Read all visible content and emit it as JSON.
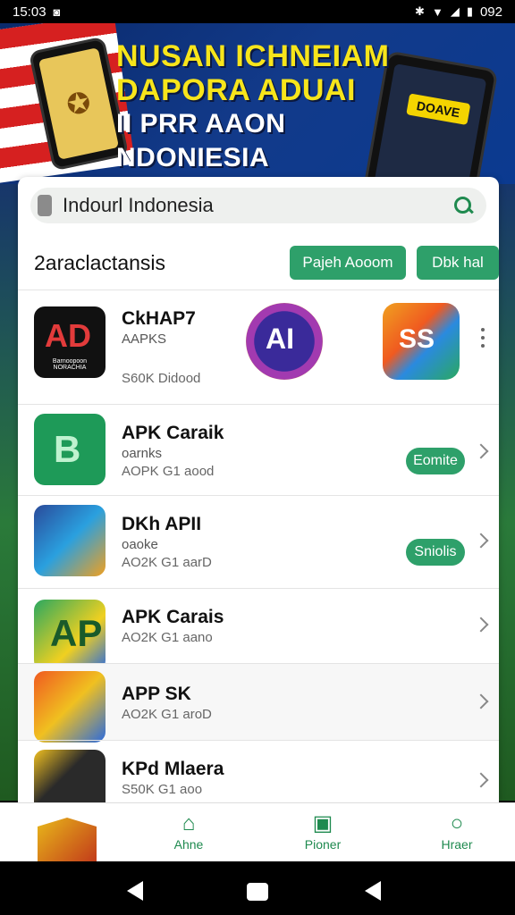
{
  "status_bar": {
    "time": "15:03",
    "battery": "092"
  },
  "banner": {
    "line1": "NUSAN ICHNEIAM",
    "line2": "DAPORA ADUAI",
    "line3": "II PRR AAON NDONIESIA",
    "phone_tag": "DOAVE"
  },
  "search": {
    "value": "Indourl Indonesia"
  },
  "section": {
    "title": "2araclactansis",
    "button_a": "Pajeh Aooom",
    "button_b": "Dbk hal"
  },
  "apps": [
    {
      "name": "CkHAP7",
      "sub": "AAPKS",
      "meta": "S60K Didood",
      "icon_text": "Barnoopoon NORACHIA"
    },
    {
      "name": "APK Caraik",
      "sub": "oarnks",
      "meta": "AOPK G1 aood",
      "action": "Eomite"
    },
    {
      "name": "DKh APII",
      "sub": "oaoke",
      "meta": "AO2K G1 aarD",
      "action": "Sniolis"
    },
    {
      "name": "APK Carais",
      "sub": "",
      "meta": "AO2K G1 aano"
    },
    {
      "name": "APP SK",
      "sub": "",
      "meta": "AO2K G1 aroD"
    },
    {
      "name": "KPd Mlaera",
      "sub": "",
      "meta": "S50K G1 aoo"
    }
  ],
  "mid_logos": {
    "logo_a": "AI",
    "logo_b": "SS"
  },
  "bottom_nav": [
    {
      "label": "Ahne"
    },
    {
      "label": "Pioner"
    },
    {
      "label": "Hraer"
    }
  ],
  "colors": {
    "accent": "#2ea06a",
    "banner_text": "#f7e51b"
  }
}
